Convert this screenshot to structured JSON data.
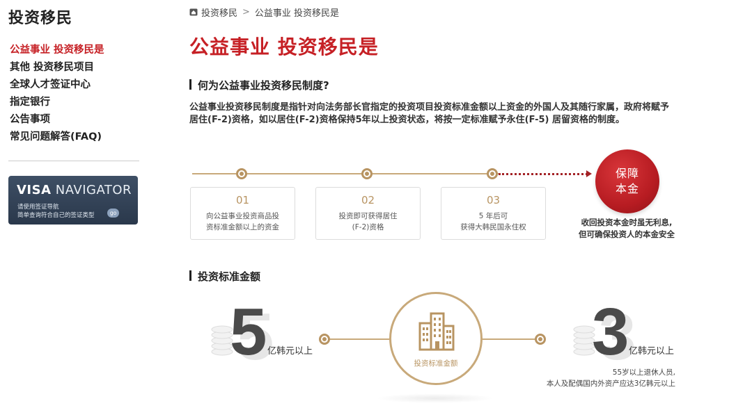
{
  "sidebar": {
    "title": "投资移民",
    "menu": [
      {
        "label": "公益事业 投资移民是",
        "active": true
      },
      {
        "label": "其他 投资移民项目",
        "active": false
      },
      {
        "label": "全球人才签证中心",
        "active": false
      },
      {
        "label": "指定银行",
        "active": false
      },
      {
        "label": "公告事项",
        "active": false
      },
      {
        "label": "常见问题解答(FAQ)",
        "active": false
      }
    ],
    "visa_banner": {
      "title_bold": "VISA",
      "title_rest": "NAVIGATOR",
      "desc_line1": "请使用签证导航",
      "desc_line2": "简单查询符合自己的签证类型",
      "go_label": "go"
    }
  },
  "breadcrumb": {
    "home_icon": "home-icon",
    "items": [
      "投资移民",
      "公益事业 投资移民是"
    ],
    "separator": ">"
  },
  "page_title": "公益事业 投资移民是",
  "section1": {
    "heading": "何为公益事业投资移民制度?",
    "description": "公益事业投资移民制度是指针对向法务部长官指定的投资项目投资标准金额以上资金的外国人及其随行家属，政府将赋予居住(F-2)资格，如以居住(F-2)资格保持5年以上投资状态，将按一定标准赋予永住(F-5) 居留资格的制度。",
    "steps": [
      {
        "num": "01",
        "line1": "向公益事业投资商品投",
        "line2": "资标准金额以上的资金"
      },
      {
        "num": "02",
        "line1": "投资即可获得居住",
        "line2": "(F-2)资格"
      },
      {
        "num": "03",
        "line1": "5  年后可",
        "line2": "获得大韩民国永住权"
      }
    ],
    "guarantee": {
      "line1": "保障",
      "line2": "本金",
      "caption1": "收回投资本金时虽无利息,",
      "caption2": "但可确保投资人的本金安全"
    }
  },
  "section2": {
    "heading": "投资标准金额",
    "left_value": "5",
    "left_unit": "亿韩元以上",
    "right_value": "3",
    "right_unit": "亿韩元以上",
    "center_label": "投资标准金额",
    "note1": "55岁以上退休人员,",
    "note2": "本人及配偶国内外资产应达3亿韩元以上"
  },
  "colors": {
    "accent_red": "#c62025",
    "gold": "#b89462",
    "navy": "#2a384b"
  }
}
